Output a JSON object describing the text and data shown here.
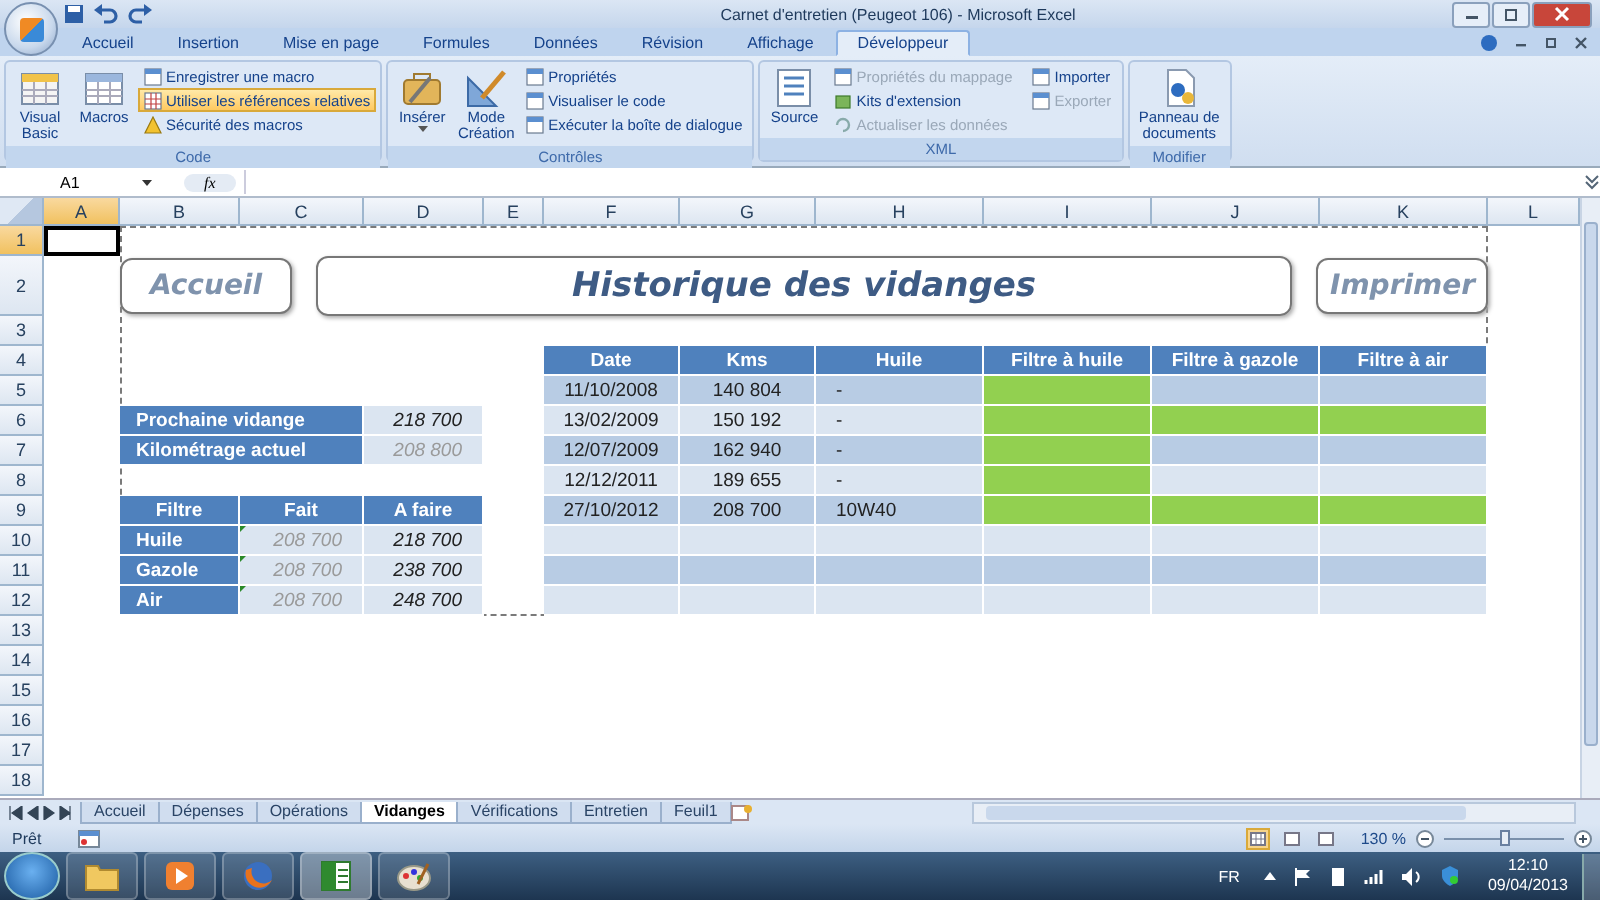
{
  "window": {
    "title": "Carnet d'entretien (Peugeot 106) - Microsoft Excel"
  },
  "ribbon_tabs": [
    {
      "label": "Accueil",
      "selected": false
    },
    {
      "label": "Insertion",
      "selected": false
    },
    {
      "label": "Mise en page",
      "selected": false
    },
    {
      "label": "Formules",
      "selected": false
    },
    {
      "label": "Données",
      "selected": false
    },
    {
      "label": "Révision",
      "selected": false
    },
    {
      "label": "Affichage",
      "selected": false
    },
    {
      "label": "Développeur",
      "selected": true
    }
  ],
  "ribbon_groups": [
    {
      "label": "Code",
      "large": [
        "Visual Basic",
        "Macros"
      ],
      "small": [
        {
          "label": "Enregistrer une macro",
          "on": false,
          "disabled": false
        },
        {
          "label": "Utiliser les références relatives",
          "on": true,
          "disabled": false
        },
        {
          "label": "Sécurité des macros",
          "on": false,
          "disabled": false
        }
      ]
    },
    {
      "label": "Contrôles",
      "large": [
        "Insérer",
        "Mode Création"
      ],
      "small": [
        {
          "label": "Propriétés",
          "on": false,
          "disabled": false
        },
        {
          "label": "Visualiser le code",
          "on": false,
          "disabled": false
        },
        {
          "label": "Exécuter la boîte de dialogue",
          "on": false,
          "disabled": false
        }
      ]
    },
    {
      "label": "XML",
      "large": [
        "Source"
      ],
      "small": [
        {
          "label": "Propriétés du mappage",
          "on": false,
          "disabled": true
        },
        {
          "label": "Kits d'extension",
          "on": false,
          "disabled": false
        },
        {
          "label": "Actualiser les données",
          "on": false,
          "disabled": true
        },
        {
          "label": "Importer",
          "on": false,
          "disabled": false
        },
        {
          "label": "Exporter",
          "on": false,
          "disabled": true
        }
      ]
    },
    {
      "label": "Modifier",
      "large": [
        "Panneau de documents"
      ]
    }
  ],
  "formula_bar": {
    "name_box": "A1",
    "function_label": "fx"
  },
  "columns": [
    {
      "label": "A",
      "selected": true
    },
    {
      "label": "B",
      "selected": false
    },
    {
      "label": "C",
      "selected": false
    },
    {
      "label": "D",
      "selected": false
    },
    {
      "label": "E",
      "selected": false
    },
    {
      "label": "F",
      "selected": false
    },
    {
      "label": "G",
      "selected": false
    },
    {
      "label": "H",
      "selected": false
    },
    {
      "label": "I",
      "selected": false
    },
    {
      "label": "J",
      "selected": false
    },
    {
      "label": "K",
      "selected": false
    },
    {
      "label": "L",
      "selected": false
    }
  ],
  "rows": [
    {
      "label": "1",
      "selected": true
    },
    {
      "label": "2",
      "selected": false
    },
    {
      "label": "3",
      "selected": false
    },
    {
      "label": "4",
      "selected": false
    },
    {
      "label": "5",
      "selected": false
    },
    {
      "label": "6",
      "selected": false
    },
    {
      "label": "7",
      "selected": false
    },
    {
      "label": "8",
      "selected": false
    },
    {
      "label": "9",
      "selected": false
    },
    {
      "label": "10",
      "selected": false
    },
    {
      "label": "11",
      "selected": false
    },
    {
      "label": "12",
      "selected": false
    },
    {
      "label": "13",
      "selected": false
    },
    {
      "label": "14",
      "selected": false
    },
    {
      "label": "15",
      "selected": false
    },
    {
      "label": "16",
      "selected": false
    },
    {
      "label": "17",
      "selected": false
    },
    {
      "label": "18",
      "selected": false
    }
  ],
  "sheet": {
    "home_button": "Accueil",
    "title": "Historique des vidanges",
    "print_button": "Imprimer",
    "summary": [
      {
        "label": "Prochaine vidange",
        "value": "218 700",
        "dim": false
      },
      {
        "label": "Kilométrage actuel",
        "value": "208 800",
        "dim": true
      }
    ],
    "filters": {
      "columns": [
        "Filtre",
        "Fait",
        "A faire"
      ],
      "rows": [
        {
          "name": "Huile",
          "done": "208 700",
          "due": "218 700"
        },
        {
          "name": "Gazole",
          "done": "208 700",
          "due": "238 700"
        },
        {
          "name": "Air",
          "done": "208 700",
          "due": "248 700"
        }
      ]
    },
    "history": {
      "columns": [
        "Date",
        "Kms",
        "Huile",
        "Filtre à huile",
        "Filtre à gazole",
        "Filtre à air"
      ],
      "rows": [
        {
          "date": "11/10/2008",
          "kms": "140 804",
          "oil": "-",
          "oil_filter": true,
          "fuel_filter": false,
          "air_filter": false
        },
        {
          "date": "13/02/2009",
          "kms": "150 192",
          "oil": "-",
          "oil_filter": true,
          "fuel_filter": true,
          "air_filter": true
        },
        {
          "date": "12/07/2009",
          "kms": "162 940",
          "oil": "-",
          "oil_filter": true,
          "fuel_filter": false,
          "air_filter": false
        },
        {
          "date": "12/12/2011",
          "kms": "189 655",
          "oil": "-",
          "oil_filter": true,
          "fuel_filter": false,
          "air_filter": false
        },
        {
          "date": "27/10/2012",
          "kms": "208 700",
          "oil": "10W40",
          "oil_filter": true,
          "fuel_filter": true,
          "air_filter": true
        }
      ]
    }
  },
  "sheet_tabs": [
    {
      "label": "Accueil",
      "selected": false
    },
    {
      "label": "Dépenses",
      "selected": false
    },
    {
      "label": "Opérations",
      "selected": false
    },
    {
      "label": "Vidanges",
      "selected": true
    },
    {
      "label": "Vérifications",
      "selected": false
    },
    {
      "label": "Entretien",
      "selected": false
    },
    {
      "label": "Feuil1",
      "selected": false
    }
  ],
  "status_bar": {
    "status": "Prêt",
    "views": [
      {
        "selected": true
      },
      {
        "selected": false
      },
      {
        "selected": false
      }
    ],
    "zoom": "130 %",
    "zoom_slider": {
      "level": 0.5
    }
  },
  "taskbar": {
    "apps": [
      {
        "selected": false
      },
      {
        "selected": false
      },
      {
        "selected": false
      },
      {
        "selected": true
      },
      {
        "selected": false
      }
    ],
    "language": "FR",
    "time": "12:10",
    "date": "09/04/2013"
  }
}
